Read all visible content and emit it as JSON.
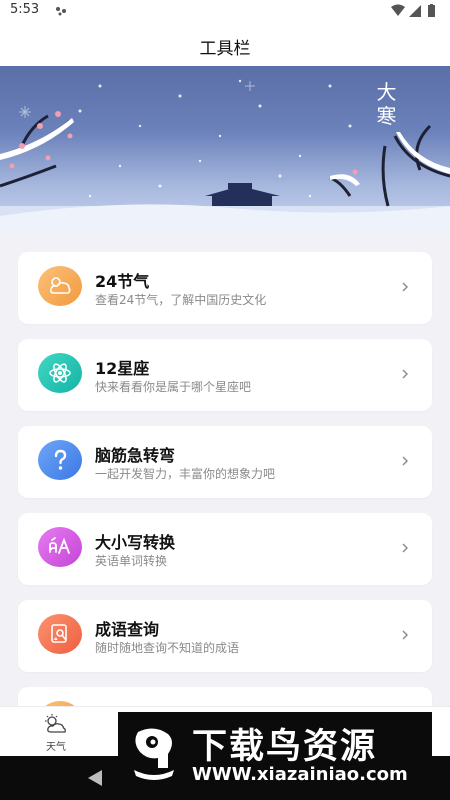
{
  "status_bar": {
    "time": "5:53"
  },
  "header": {
    "title": "工具栏"
  },
  "banner": {
    "text": "大寒"
  },
  "tools": [
    {
      "title": "24节气",
      "subtitle": "查看24节气，了解中国历史文化",
      "icon": "cloud-icon",
      "color": "#f6a54b"
    },
    {
      "title": "12星座",
      "subtitle": "快来看看你是属于哪个星座吧",
      "icon": "atom-icon",
      "color": "#1ec3b0"
    },
    {
      "title": "脑筋急转弯",
      "subtitle": "一起开发智力，丰富你的想象力吧",
      "icon": "question-icon",
      "color": "#4a86ee"
    },
    {
      "title": "大小写转换",
      "subtitle": "英语单词转换",
      "icon": "letter-case-icon",
      "color": "#d457e0"
    },
    {
      "title": "成语查询",
      "subtitle": "随时随地查询不知道的成语",
      "icon": "search-doc-icon",
      "color": "#f46d4a"
    }
  ],
  "tab_bar": {
    "tabs": [
      {
        "label": "天气",
        "icon": "weather-icon"
      }
    ]
  },
  "watermark": {
    "text": "下载鸟资源",
    "url": "WWW.xiazainiao.com"
  }
}
